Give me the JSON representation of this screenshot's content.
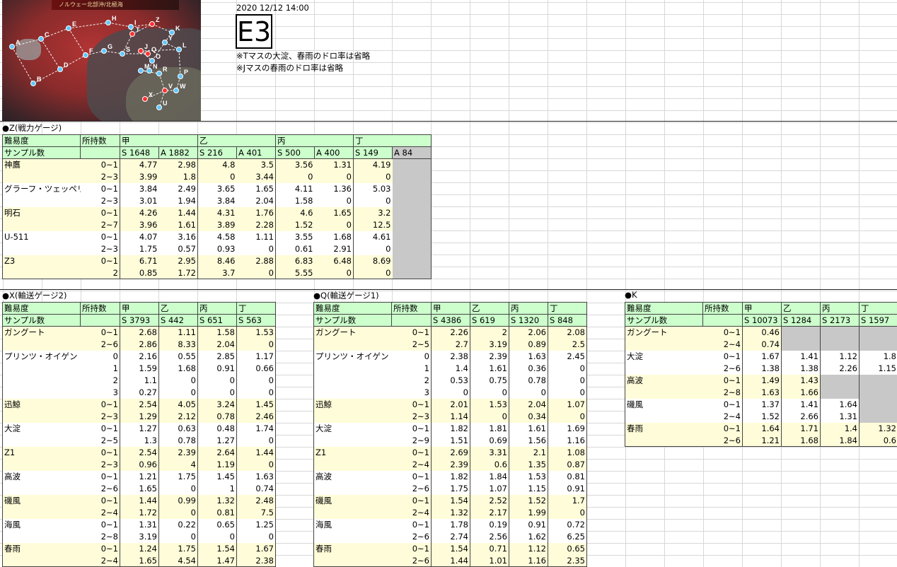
{
  "header": {
    "date": "2020 12/12 14:00",
    "title": "E3",
    "note1": "※Tマスの大淀、春雨のドロ率は省略",
    "note2": "※Jマスの春雨のドロ率は省略"
  },
  "map": {
    "banner": "ノルウェー北部沖/北極海",
    "nodes": [
      "A",
      "B",
      "C",
      "D",
      "E",
      "F",
      "G",
      "H",
      "I",
      "J",
      "K",
      "L",
      "M",
      "N",
      "O",
      "P",
      "Q",
      "R",
      "S",
      "T",
      "U",
      "V",
      "W",
      "X",
      "Y",
      "Z"
    ]
  },
  "tables": [
    {
      "id": "z",
      "title": "●Z(戦力ゲージ)",
      "label_difficulty": "難易度",
      "label_samples": "サンプル数",
      "label_owned": "所持数",
      "difficulties": [
        "甲",
        "乙",
        "丙",
        "丁"
      ],
      "sample_cells": [
        "S 1648",
        "A 1882",
        "S 216",
        "A 401",
        "S 500",
        "A 400",
        "S 149",
        "A 84"
      ],
      "rows": [
        {
          "ship": "神鷹",
          "owned": "0~1",
          "vals": [
            "4.77",
            "2.98",
            "4.8",
            "3.5",
            "3.56",
            "1.31",
            "4.19",
            ""
          ]
        },
        {
          "ship": "",
          "owned": "2~3",
          "vals": [
            "3.99",
            "1.8",
            "0",
            "3.44",
            "0",
            "0",
            "0",
            ""
          ]
        },
        {
          "ship": "グラーフ・ツェッペリン",
          "owned": "0~1",
          "vals": [
            "3.84",
            "2.49",
            "3.65",
            "1.65",
            "4.11",
            "1.36",
            "5.03",
            ""
          ]
        },
        {
          "ship": "",
          "owned": "2~3",
          "vals": [
            "3.01",
            "1.94",
            "3.84",
            "2.04",
            "1.58",
            "0",
            "0",
            ""
          ]
        },
        {
          "ship": "明石",
          "owned": "0~1",
          "vals": [
            "4.26",
            "1.44",
            "4.31",
            "1.76",
            "4.6",
            "1.65",
            "3.2",
            ""
          ]
        },
        {
          "ship": "",
          "owned": "2~7",
          "vals": [
            "3.96",
            "1.61",
            "3.89",
            "2.28",
            "1.52",
            "0",
            "12.5",
            ""
          ]
        },
        {
          "ship": "U-511",
          "owned": "0~1",
          "vals": [
            "4.07",
            "3.16",
            "4.58",
            "1.11",
            "3.55",
            "1.68",
            "4.61",
            ""
          ]
        },
        {
          "ship": "",
          "owned": "2~3",
          "vals": [
            "1.75",
            "0.57",
            "0.93",
            "0",
            "0.61",
            "2.91",
            "0",
            ""
          ]
        },
        {
          "ship": "Z3",
          "owned": "0~1",
          "vals": [
            "6.71",
            "2.95",
            "8.46",
            "2.88",
            "6.83",
            "6.48",
            "8.69",
            ""
          ]
        },
        {
          "ship": "",
          "owned": "2",
          "vals": [
            "0.85",
            "1.72",
            "3.7",
            "0",
            "5.55",
            "0",
            "0",
            ""
          ]
        }
      ]
    },
    {
      "id": "x",
      "title": "●X(輸送ゲージ2)",
      "label_difficulty": "難易度",
      "label_samples": "サンプル数",
      "label_owned": "所持数",
      "difficulties": [
        "甲",
        "乙",
        "丙",
        "丁"
      ],
      "sample_cells": [
        "S 3793",
        "S 442",
        "S 651",
        "S 563"
      ],
      "rows": [
        {
          "ship": "ガングート",
          "owned": "0~1",
          "vals": [
            "2.68",
            "1.11",
            "1.58",
            "1.53"
          ]
        },
        {
          "ship": "",
          "owned": "2~6",
          "vals": [
            "2.86",
            "8.33",
            "2.04",
            "0"
          ]
        },
        {
          "ship": "プリンツ・オイゲン",
          "owned": "0",
          "vals": [
            "2.16",
            "0.55",
            "2.85",
            "1.17"
          ]
        },
        {
          "ship": "",
          "owned": "1",
          "vals": [
            "1.59",
            "1.68",
            "0.91",
            "0.66"
          ]
        },
        {
          "ship": "",
          "owned": "2",
          "vals": [
            "1.1",
            "0",
            "0",
            "0"
          ]
        },
        {
          "ship": "",
          "owned": "3",
          "vals": [
            "0.27",
            "0",
            "0",
            "0"
          ]
        },
        {
          "ship": "迅鯨",
          "owned": "0~1",
          "vals": [
            "2.54",
            "4.05",
            "3.24",
            "1.45"
          ]
        },
        {
          "ship": "",
          "owned": "2~3",
          "vals": [
            "1.29",
            "2.12",
            "0.78",
            "2.46"
          ]
        },
        {
          "ship": "大淀",
          "owned": "0~1",
          "vals": [
            "1.27",
            "0.63",
            "0.48",
            "1.74"
          ]
        },
        {
          "ship": "",
          "owned": "2~5",
          "vals": [
            "1.3",
            "0.78",
            "1.27",
            "0"
          ]
        },
        {
          "ship": "Z1",
          "owned": "0~1",
          "vals": [
            "2.54",
            "2.39",
            "2.64",
            "1.44"
          ]
        },
        {
          "ship": "",
          "owned": "2~3",
          "vals": [
            "0.96",
            "4",
            "1.19",
            "0"
          ]
        },
        {
          "ship": "高波",
          "owned": "0~1",
          "vals": [
            "1.21",
            "1.75",
            "1.45",
            "1.63"
          ]
        },
        {
          "ship": "",
          "owned": "2~6",
          "vals": [
            "1.65",
            "0",
            "1",
            "0.74"
          ]
        },
        {
          "ship": "磯風",
          "owned": "0~1",
          "vals": [
            "1.44",
            "0.99",
            "1.32",
            "2.48"
          ]
        },
        {
          "ship": "",
          "owned": "2~4",
          "vals": [
            "1.72",
            "0",
            "0.81",
            "7.5"
          ]
        },
        {
          "ship": "海風",
          "owned": "0~1",
          "vals": [
            "1.31",
            "0.22",
            "0.65",
            "1.25"
          ]
        },
        {
          "ship": "",
          "owned": "2~8",
          "vals": [
            "3.19",
            "0",
            "0",
            "0"
          ]
        },
        {
          "ship": "春雨",
          "owned": "0~1",
          "vals": [
            "1.24",
            "1.75",
            "1.54",
            "1.67"
          ]
        },
        {
          "ship": "",
          "owned": "2~4",
          "vals": [
            "1.65",
            "4.54",
            "1.47",
            "2.38"
          ]
        }
      ]
    },
    {
      "id": "q",
      "title": "●Q(輸送ゲージ1)",
      "label_difficulty": "難易度",
      "label_samples": "サンプル数",
      "label_owned": "所持数",
      "difficulties": [
        "甲",
        "乙",
        "丙",
        "丁"
      ],
      "sample_cells": [
        "S 4386",
        "S 619",
        "S 1320",
        "S 848"
      ],
      "rows": [
        {
          "ship": "ガングート",
          "owned": "0~1",
          "vals": [
            "2.26",
            "2",
            "2.06",
            "2.08"
          ]
        },
        {
          "ship": "",
          "owned": "2~5",
          "vals": [
            "2.7",
            "3.19",
            "0.89",
            "2.5"
          ]
        },
        {
          "ship": "プリンツ・オイゲン",
          "owned": "0",
          "vals": [
            "2.38",
            "2.39",
            "1.63",
            "2.45"
          ]
        },
        {
          "ship": "",
          "owned": "1",
          "vals": [
            "1.4",
            "1.61",
            "0.36",
            "0"
          ]
        },
        {
          "ship": "",
          "owned": "2",
          "vals": [
            "0.53",
            "0.75",
            "0.78",
            "0"
          ]
        },
        {
          "ship": "",
          "owned": "3",
          "vals": [
            "0",
            "0",
            "0",
            "0"
          ]
        },
        {
          "ship": "迅鯨",
          "owned": "0~1",
          "vals": [
            "2.01",
            "1.53",
            "2.04",
            "1.07"
          ]
        },
        {
          "ship": "",
          "owned": "2~3",
          "vals": [
            "1.14",
            "0",
            "0.34",
            "0"
          ]
        },
        {
          "ship": "大淀",
          "owned": "0~1",
          "vals": [
            "1.82",
            "1.81",
            "1.61",
            "1.69"
          ]
        },
        {
          "ship": "",
          "owned": "2~9",
          "vals": [
            "1.51",
            "0.69",
            "1.56",
            "1.16"
          ]
        },
        {
          "ship": "Z1",
          "owned": "0~1",
          "vals": [
            "2.69",
            "3.31",
            "2.1",
            "1.08"
          ]
        },
        {
          "ship": "",
          "owned": "2~4",
          "vals": [
            "2.39",
            "0.6",
            "1.35",
            "0.87"
          ]
        },
        {
          "ship": "高波",
          "owned": "0~1",
          "vals": [
            "1.82",
            "1.84",
            "1.53",
            "0.81"
          ]
        },
        {
          "ship": "",
          "owned": "2~6",
          "vals": [
            "1.75",
            "1.07",
            "1.15",
            "0.91"
          ]
        },
        {
          "ship": "磯風",
          "owned": "0~1",
          "vals": [
            "1.54",
            "2.52",
            "1.52",
            "1.7"
          ]
        },
        {
          "ship": "",
          "owned": "2~4",
          "vals": [
            "1.32",
            "2.17",
            "1.99",
            "0"
          ]
        },
        {
          "ship": "海風",
          "owned": "0~1",
          "vals": [
            "1.78",
            "0.19",
            "0.91",
            "0.72"
          ]
        },
        {
          "ship": "",
          "owned": "2~6",
          "vals": [
            "2.74",
            "2.56",
            "1.62",
            "6.25"
          ]
        },
        {
          "ship": "春雨",
          "owned": "0~1",
          "vals": [
            "1.54",
            "0.71",
            "1.12",
            "0.65"
          ]
        },
        {
          "ship": "",
          "owned": "2~6",
          "vals": [
            "1.44",
            "1.01",
            "1.16",
            "2.35"
          ]
        }
      ]
    },
    {
      "id": "k",
      "title": "●K",
      "label_difficulty": "難易度",
      "label_samples": "サンプル数",
      "label_owned": "所持数",
      "difficulties": [
        "甲",
        "乙",
        "丙",
        "丁"
      ],
      "sample_cells": [
        "S 10073",
        "S 1284",
        "S 2173",
        "S 1597"
      ],
      "rows": [
        {
          "ship": "ガングート",
          "owned": "0~1",
          "vals": [
            "0.46",
            "",
            "",
            ""
          ]
        },
        {
          "ship": "",
          "owned": "2~4",
          "vals": [
            "0.74",
            "",
            "",
            ""
          ]
        },
        {
          "ship": "大淀",
          "owned": "0~1",
          "vals": [
            "1.67",
            "1.41",
            "1.12",
            "1.8"
          ]
        },
        {
          "ship": "",
          "owned": "2~6",
          "vals": [
            "1.38",
            "1.38",
            "2.26",
            "1.15"
          ]
        },
        {
          "ship": "高波",
          "owned": "0~1",
          "vals": [
            "1.49",
            "1.43",
            "",
            ""
          ]
        },
        {
          "ship": "",
          "owned": "2~8",
          "vals": [
            "1.63",
            "1.66",
            "",
            ""
          ]
        },
        {
          "ship": "磯風",
          "owned": "0~1",
          "vals": [
            "1.37",
            "1.41",
            "1.64",
            ""
          ]
        },
        {
          "ship": "",
          "owned": "2~4",
          "vals": [
            "1.52",
            "2.66",
            "1.31",
            ""
          ]
        },
        {
          "ship": "春雨",
          "owned": "0~1",
          "vals": [
            "1.64",
            "1.71",
            "1.4",
            "1.32"
          ]
        },
        {
          "ship": "",
          "owned": "2~6",
          "vals": [
            "1.21",
            "1.68",
            "1.84",
            "0.6"
          ]
        }
      ]
    }
  ]
}
